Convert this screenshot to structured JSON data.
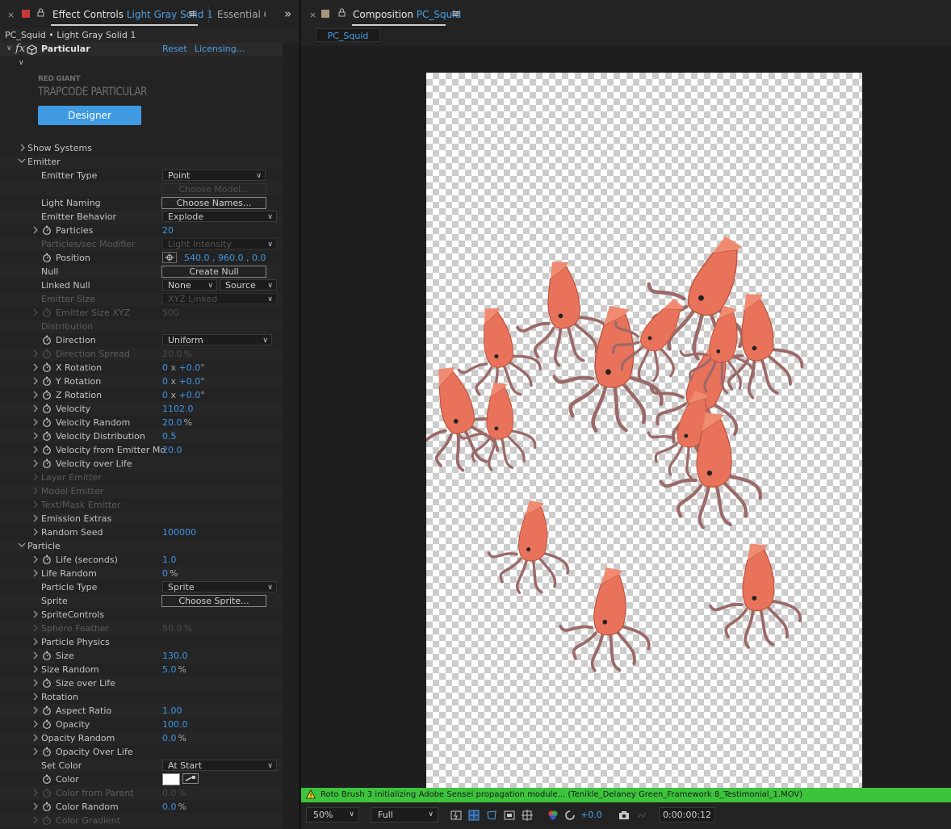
{
  "left_tabs": {
    "close": "×",
    "effect_controls_label": "Effect Controls",
    "effect_controls_layer": "Light Gray Solid 1",
    "essential_label": "Essential Gr",
    "overflow": "»",
    "menu": "≡"
  },
  "layer_path": "PC_Squid • Light Gray Solid 1",
  "effect": {
    "name": "Particular",
    "reset": "Reset",
    "licensing": "Licensing...",
    "brand_top": "RED GIANT",
    "brand_name": "TRAPCODE PARTICULAR",
    "designer": "Designer"
  },
  "params": [
    {
      "label": "Show Systems",
      "arrow": true,
      "indent": 0
    },
    {
      "label": "Emitter",
      "arrow": "open",
      "indent": 0
    },
    {
      "label": "Emitter Type",
      "indent": 1,
      "dropdown": "Point",
      "ddw": 128
    },
    {
      "label": "",
      "indent": 1,
      "button": "Choose Model...",
      "dim_button": true
    },
    {
      "label": "Light Naming",
      "indent": 1,
      "button": "Choose Names..."
    },
    {
      "label": "Emitter Behavior",
      "indent": 1,
      "dropdown": "Explode",
      "ddw": 142
    },
    {
      "label": "Particles",
      "indent": 2,
      "arrow": true,
      "stopwatch": true,
      "value": "20"
    },
    {
      "label": "Particles/sec Modifier",
      "indent": 1,
      "dim": true,
      "dropdown": "Light Intensity",
      "ddw": 142,
      "dim_dd": true
    },
    {
      "label": "Position",
      "indent": 2,
      "stopwatch": true,
      "position": "540.0 , 960.0 , 0.0"
    },
    {
      "label": "Null",
      "indent": 1,
      "button": "Create Null"
    },
    {
      "label": "Linked Null",
      "indent": 1,
      "dual": [
        "None",
        "Source"
      ]
    },
    {
      "label": "Emitter Size",
      "indent": 1,
      "dim": true,
      "dropdown": "XYZ Linked",
      "ddw": 142,
      "dim_dd": true
    },
    {
      "label": "Emitter Size XYZ",
      "indent": 2,
      "arrow": true,
      "stopwatch": true,
      "dim": true,
      "value": "500"
    },
    {
      "label": "Distribution",
      "indent": 1,
      "dim": true
    },
    {
      "label": "Direction",
      "indent": 2,
      "stopwatch": true,
      "dropdown": "Uniform",
      "ddw": 136
    },
    {
      "label": "Direction Spread",
      "indent": 2,
      "arrow": true,
      "stopwatch": true,
      "dim": true,
      "value": "20.0",
      "unit": "%"
    },
    {
      "label": "X Rotation",
      "indent": 2,
      "arrow": true,
      "stopwatch": true,
      "rotation": [
        "0",
        "+0.0"
      ]
    },
    {
      "label": "Y Rotation",
      "indent": 2,
      "arrow": true,
      "stopwatch": true,
      "rotation": [
        "0",
        "+0.0"
      ]
    },
    {
      "label": "Z Rotation",
      "indent": 2,
      "arrow": true,
      "stopwatch": true,
      "rotation": [
        "0",
        "+0.0"
      ]
    },
    {
      "label": "Velocity",
      "indent": 2,
      "arrow": true,
      "stopwatch": true,
      "value": "1102.0"
    },
    {
      "label": "Velocity Random",
      "indent": 2,
      "arrow": true,
      "stopwatch": true,
      "value": "20.0",
      "unit": "%"
    },
    {
      "label": "Velocity Distribution",
      "indent": 2,
      "arrow": true,
      "stopwatch": true,
      "value": "0.5"
    },
    {
      "label": "Velocity from Emitter Mo",
      "indent": 2,
      "arrow": true,
      "stopwatch": true,
      "value": "20.0"
    },
    {
      "label": "Velocity over Life",
      "indent": 2,
      "arrow": true,
      "stopwatch": true
    },
    {
      "label": "Layer Emitter",
      "indent": 1,
      "arrow": true,
      "dim": true
    },
    {
      "label": "Model Emitter",
      "indent": 1,
      "arrow": true,
      "dim": true
    },
    {
      "label": "Text/Mask Emitter",
      "indent": 1,
      "arrow": true,
      "dim": true
    },
    {
      "label": "Emission Extras",
      "indent": 1,
      "arrow": true
    },
    {
      "label": "Random Seed",
      "indent": 1,
      "arrow": true,
      "value": "100000"
    },
    {
      "label": "Particle",
      "arrow": "open",
      "indent": 0
    },
    {
      "label": "Life (seconds)",
      "indent": 2,
      "arrow": true,
      "stopwatch": true,
      "value": "1.0"
    },
    {
      "label": "Life Random",
      "indent": 1,
      "arrow": true,
      "value": "0",
      "unit": "%"
    },
    {
      "label": "Particle Type",
      "indent": 1,
      "dropdown": "Sprite",
      "ddw": 142
    },
    {
      "label": "Sprite",
      "indent": 1,
      "button": "Choose Sprite..."
    },
    {
      "label": "SpriteControls",
      "indent": 1,
      "arrow": true
    },
    {
      "label": "Sphere Feather",
      "indent": 1,
      "arrow": true,
      "dim": true,
      "value": "50.0",
      "unit": "%"
    },
    {
      "label": "Particle Physics",
      "indent": 1,
      "arrow": true
    },
    {
      "label": "Size",
      "indent": 2,
      "arrow": true,
      "stopwatch": true,
      "value": "130.0"
    },
    {
      "label": "Size Random",
      "indent": 1,
      "arrow": true,
      "value": "5.0",
      "unit": "%"
    },
    {
      "label": "Size over Life",
      "indent": 2,
      "arrow": true,
      "stopwatch": true
    },
    {
      "label": "Rotation",
      "indent": 1,
      "arrow": true
    },
    {
      "label": "Aspect Ratio",
      "indent": 2,
      "arrow": true,
      "stopwatch": true,
      "value": "1.00"
    },
    {
      "label": "Opacity",
      "indent": 2,
      "arrow": true,
      "stopwatch": true,
      "value": "100.0"
    },
    {
      "label": "Opacity Random",
      "indent": 1,
      "arrow": true,
      "value": "0.0",
      "unit": "%"
    },
    {
      "label": "Opacity Over Life",
      "indent": 2,
      "arrow": true,
      "stopwatch": true
    },
    {
      "label": "Set Color",
      "indent": 1,
      "dropdown": "At Start",
      "ddw": 142
    },
    {
      "label": "Color",
      "indent": 2,
      "stopwatch": true,
      "color": "#ffffff"
    },
    {
      "label": "Color from Parent",
      "indent": 2,
      "arrow": true,
      "stopwatch": true,
      "dim": true,
      "value": "0.0",
      "unit": "%"
    },
    {
      "label": "Color Random",
      "indent": 2,
      "arrow": true,
      "stopwatch": true,
      "value": "0.0",
      "unit": "%"
    },
    {
      "label": "Color Gradient",
      "indent": 2,
      "arrow": true,
      "stopwatch": true,
      "dim": true
    }
  ],
  "comp_tabs": {
    "close": "×",
    "label": "Composition",
    "comp_name": "PC_Squid",
    "menu": "≡",
    "chip": "PC_Squid"
  },
  "status_message": "Roto Brush 3 initializing Adobe Sensei propagation module... (Tenikle_Delaney Green_Framework 8_Testimonial_1.MOV)",
  "viewer_toolbar": {
    "zoom": "50%",
    "resolution": "Full",
    "exposure": "+0.0",
    "timecode": "0:00:00:12"
  },
  "colors": {
    "accent_blue": "#3e96e6",
    "designer_button": "#3f9ae1",
    "status_green": "#3cc43c",
    "squid": "#e8735a"
  }
}
